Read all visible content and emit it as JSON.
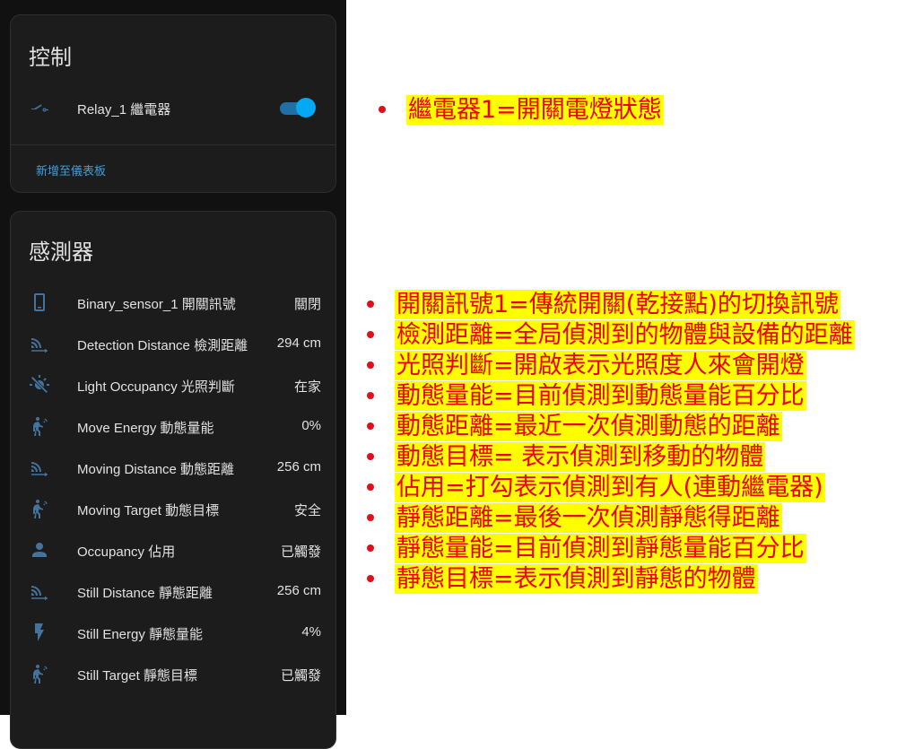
{
  "control_card": {
    "title": "控制",
    "relay": {
      "icon": "relay-icon",
      "name": "Relay_1 繼電器",
      "state": "on"
    },
    "add_to_dashboard": "新增至儀表板"
  },
  "sensor_card": {
    "title": "感測器",
    "rows": [
      {
        "icon": "phone-icon",
        "name": "Binary_sensor_1 開關訊號",
        "value": "關閉"
      },
      {
        "icon": "signal-distance-icon",
        "name": "Detection Distance 檢測距離",
        "value": "294 cm"
      },
      {
        "icon": "light-off-icon",
        "name": "Light Occupancy 光照判斷",
        "value": "在家"
      },
      {
        "icon": "motion-sensor-icon",
        "name": "Move Energy 動態量能",
        "value": "0%"
      },
      {
        "icon": "signal-distance-icon",
        "name": "Moving Distance 動態距離",
        "value": "256 cm"
      },
      {
        "icon": "motion-sensor-icon",
        "name": "Moving Target 動態目標",
        "value": "安全"
      },
      {
        "icon": "account-icon",
        "name": "Occupancy 佔用",
        "value": "已觸發"
      },
      {
        "icon": "signal-distance-icon",
        "name": "Still Distance 靜態距離",
        "value": "256 cm"
      },
      {
        "icon": "flash-icon",
        "name": "Still Energy 靜態量能",
        "value": "4%"
      },
      {
        "icon": "motion-sensor-icon",
        "name": "Still Target 靜態目標",
        "value": "已觸發"
      }
    ]
  },
  "annotations": {
    "relay_note": "繼電器1=開關電燈狀態",
    "sensor_notes": [
      "開關訊號1=傳統開關(乾接點)的切換訊號",
      "檢測距離=全局偵測到的物體與設備的距離",
      "光照判斷=開啟表示光照度人來會開燈",
      "動態量能=目前偵測到動態量能百分比",
      "動態距離=最近一次偵測動態的距離",
      "動態目標= 表示偵測到移動的物體",
      "佔用=打勾表示偵測到有人(連動繼電器)",
      "靜態距離=最後一次偵測靜態得距離",
      "靜態量能=目前偵測到靜態量能百分比",
      "靜態目標=表示偵測到靜態的物體"
    ]
  },
  "colors": {
    "icon": "#44739e",
    "toggle_on": "#03a9f4",
    "link": "#3d9fe0",
    "highlight": "#ffff00",
    "note_text": "#ee0000",
    "bullet": "#e0101a"
  }
}
